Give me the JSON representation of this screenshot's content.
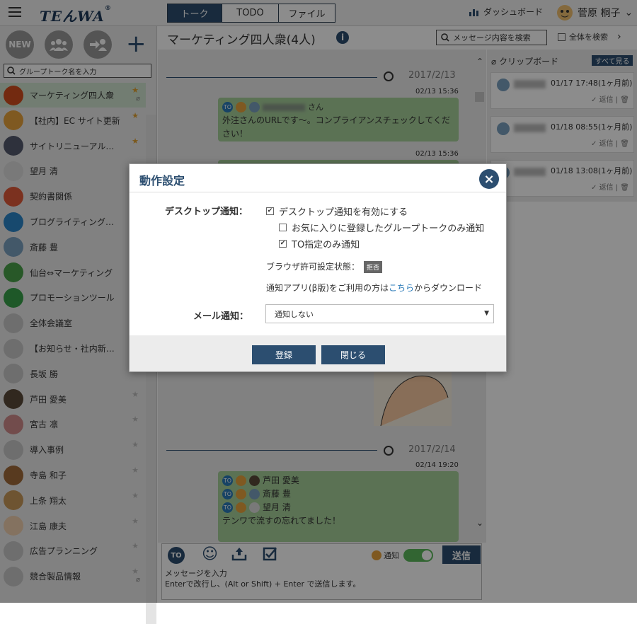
{
  "header": {
    "logo": "TEんWA",
    "logo_sup": "®",
    "tabs": [
      {
        "label": "トーク"
      },
      {
        "label": "TODO"
      },
      {
        "label": "ファイル"
      }
    ],
    "dashboard_label": "ダッシュボード",
    "user_name": "菅原 桐子"
  },
  "sidebar": {
    "new_label": "NEW",
    "search_placeholder": "グループトーク名を入力",
    "rooms": [
      {
        "name": "マーケティング四人衆",
        "color": "#d24e1e"
      },
      {
        "name": "【社内】EC サイト更新",
        "color": "#e8a23c"
      },
      {
        "name": "サイトリニューアル…",
        "color": "#555a6e"
      },
      {
        "name": "望月 清",
        "color": "#dcdcdc"
      },
      {
        "name": "契約書関係",
        "color": "#e05a3a"
      },
      {
        "name": "ブログライティング…",
        "color": "#2a86c8"
      },
      {
        "name": "斎藤 豊",
        "color": "#7aa0c0"
      },
      {
        "name": "仙台⇔マーケティング",
        "color": "#4aa04a"
      },
      {
        "name": "プロモーションツール",
        "color": "#38a04a"
      },
      {
        "name": "全体会議室",
        "color": "#c8c8c8"
      },
      {
        "name": "【お知らせ・社内新…",
        "color": "#c8c8c8"
      },
      {
        "name": "長坂 勝",
        "color": "#c8c8c8"
      },
      {
        "name": "芦田 愛美",
        "color": "#5a4a3a"
      },
      {
        "name": "宮古 凛",
        "color": "#d08a8a"
      },
      {
        "name": "導入事例",
        "color": "#c8c8c8"
      },
      {
        "name": "寺島 和子",
        "color": "#a06a3a"
      },
      {
        "name": "上条 翔太",
        "color": "#c89a5a"
      },
      {
        "name": "江島 康夫",
        "color": "#f0d0b0"
      },
      {
        "name": "広告プランニング",
        "color": "#c8c8c8"
      },
      {
        "name": "競合製品情報",
        "color": "#c8c8c8"
      }
    ]
  },
  "main": {
    "room_title": "マーケティング四人衆(4人)",
    "search_messages": "メッセージ内容を検索",
    "search_all": "全体を検索",
    "date1": "2017/2/13",
    "date2": "2017/2/14",
    "msg1": {
      "time": "02/13 15:36",
      "to": "TO",
      "suffix": "さん",
      "text": "外注さんのURLです〜。コンプライアンスチェックしてください！"
    },
    "msg2_time": "02/13 15:36",
    "msg3": {
      "time": "02/14 19:20",
      "to1": "芦田 愛美",
      "to2": "斎藤 豊",
      "to3": "望月 清",
      "text": "テンワで流すの忘れてました！"
    },
    "to_label": "TO"
  },
  "clipboard": {
    "title": "クリップボード",
    "see_all": "すべて見る",
    "items": [
      {
        "time": "01/17 17:48(1ヶ月前)",
        "action": "返信"
      },
      {
        "time": "01/18 08:55(1ヶ月前)",
        "action": "返信"
      },
      {
        "time": "01/18 13:08(1ヶ月前)",
        "action": "返信"
      }
    ]
  },
  "composer": {
    "notify_label": "通知",
    "send_label": "送信",
    "placeholder_line1": "メッセージを入力",
    "placeholder_line2": "Enterで改行し、(Alt or Shift) + Enter で送信します。"
  },
  "modal": {
    "title": "動作設定",
    "desktop_label": "デスクトップ通知：",
    "opt1": "デスクトップ通知を有効にする",
    "opt2": "お気に入りに登録したグループトークのみ通知",
    "opt3": "TO指定のみ通知",
    "browser_status": "ブラウザ許可設定状態：",
    "browser_badge": "拒否",
    "app_prefix": "通知アプリ(β版)をご利用の方は",
    "app_link": "こちら",
    "app_suffix": "からダウンロード",
    "mail_label": "メール通知：",
    "mail_value": "通知しない",
    "register_label": "登録",
    "close_label": "閉じる"
  }
}
